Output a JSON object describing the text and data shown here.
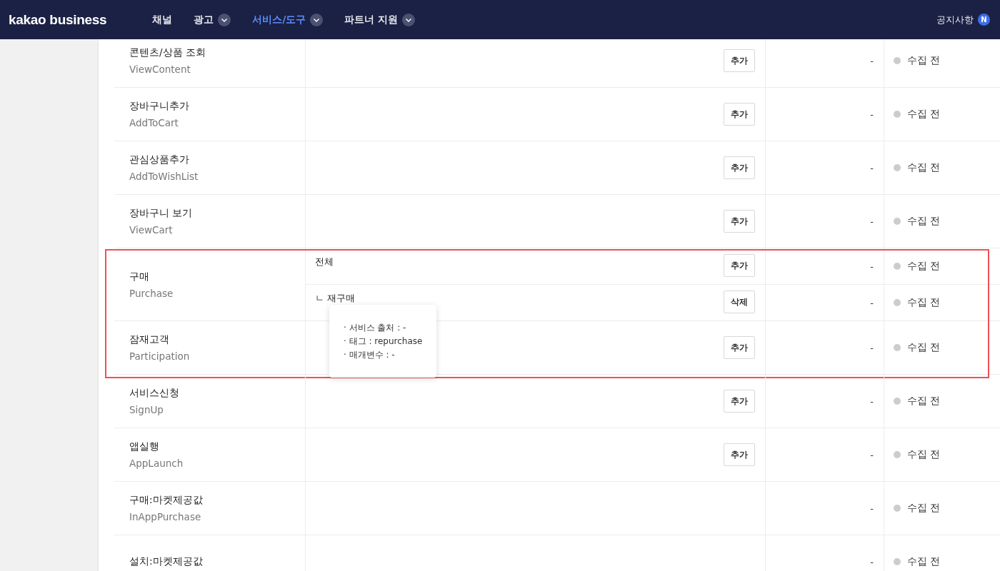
{
  "header": {
    "logo": "kakao business",
    "nav": [
      {
        "label": "채널",
        "selected": false,
        "dropdown": false
      },
      {
        "label": "광고",
        "selected": false,
        "dropdown": true
      },
      {
        "label": "서비스/도구",
        "selected": true,
        "dropdown": true
      },
      {
        "label": "파트너 지원",
        "selected": false,
        "dropdown": true
      }
    ],
    "notice": {
      "label": "공지사항",
      "badge": "N"
    }
  },
  "event_groups": [
    {
      "highlighted": false,
      "events": [
        {
          "name": "콘텐츠/상품 조회",
          "code": "ViewContent",
          "rows": [
            {
              "button": "추가",
              "value": "-",
              "status": "수집 전"
            }
          ]
        },
        {
          "name": "장바구니추가",
          "code": "AddToCart",
          "rows": [
            {
              "button": "추가",
              "value": "-",
              "status": "수집 전"
            }
          ]
        },
        {
          "name": "관심상품추가",
          "code": "AddToWishList",
          "rows": [
            {
              "button": "추가",
              "value": "-",
              "status": "수집 전"
            }
          ]
        },
        {
          "name": "장바구니 보기",
          "code": "ViewCart",
          "rows": [
            {
              "button": "추가",
              "value": "-",
              "status": "수집 전"
            }
          ]
        }
      ]
    },
    {
      "highlighted": true,
      "events": [
        {
          "name": "구매",
          "code": "Purchase",
          "rows": [
            {
              "label": "전체",
              "button": "추가",
              "value": "-",
              "status": "수집 전"
            },
            {
              "label": "ㄴ 재구매",
              "button": "삭제",
              "value": "-",
              "status": "수집 전",
              "tooltip": [
                "· 서비스 출처 : -",
                "· 태그 : repurchase",
                "· 매개변수 : -"
              ]
            }
          ]
        },
        {
          "name": "잠재고객",
          "code": "Participation",
          "rows": [
            {
              "button": "추가",
              "value": "-",
              "status": "수집 전"
            }
          ]
        }
      ]
    },
    {
      "highlighted": false,
      "events": [
        {
          "name": "서비스신청",
          "code": "SignUp",
          "rows": [
            {
              "button": "추가",
              "value": "-",
              "status": "수집 전"
            }
          ]
        },
        {
          "name": "앱실행",
          "code": "AppLaunch",
          "rows": [
            {
              "button": "추가",
              "value": "-",
              "status": "수집 전"
            }
          ]
        },
        {
          "name": "구매:마켓제공값",
          "code": "InAppPurchase",
          "rows": [
            {
              "value": "-",
              "status": "수집 전"
            }
          ]
        },
        {
          "name": "설치:마켓제공값",
          "rows": [
            {
              "value": "-",
              "status": "수집 전"
            }
          ]
        }
      ]
    }
  ]
}
